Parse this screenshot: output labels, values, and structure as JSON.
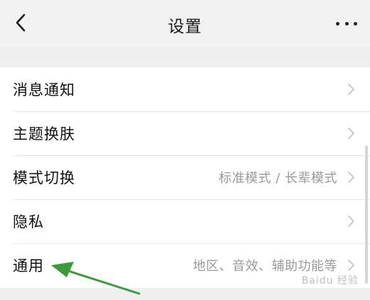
{
  "header": {
    "title": "设置",
    "back_icon": "chevron-left-icon",
    "more_icon": "more-dots-icon"
  },
  "settings": {
    "items": [
      {
        "label": "消息通知",
        "value": ""
      },
      {
        "label": "主题换肤",
        "value": ""
      },
      {
        "label": "模式切换",
        "value": "标准模式 / 长辈模式"
      },
      {
        "label": "隐私",
        "value": ""
      },
      {
        "label": "通用",
        "value": "地区、音效、辅助功能等"
      }
    ]
  },
  "watermark": "Baidu 经验",
  "colors": {
    "background": "#efefef",
    "annotation_arrow": "#3c9a3c"
  }
}
